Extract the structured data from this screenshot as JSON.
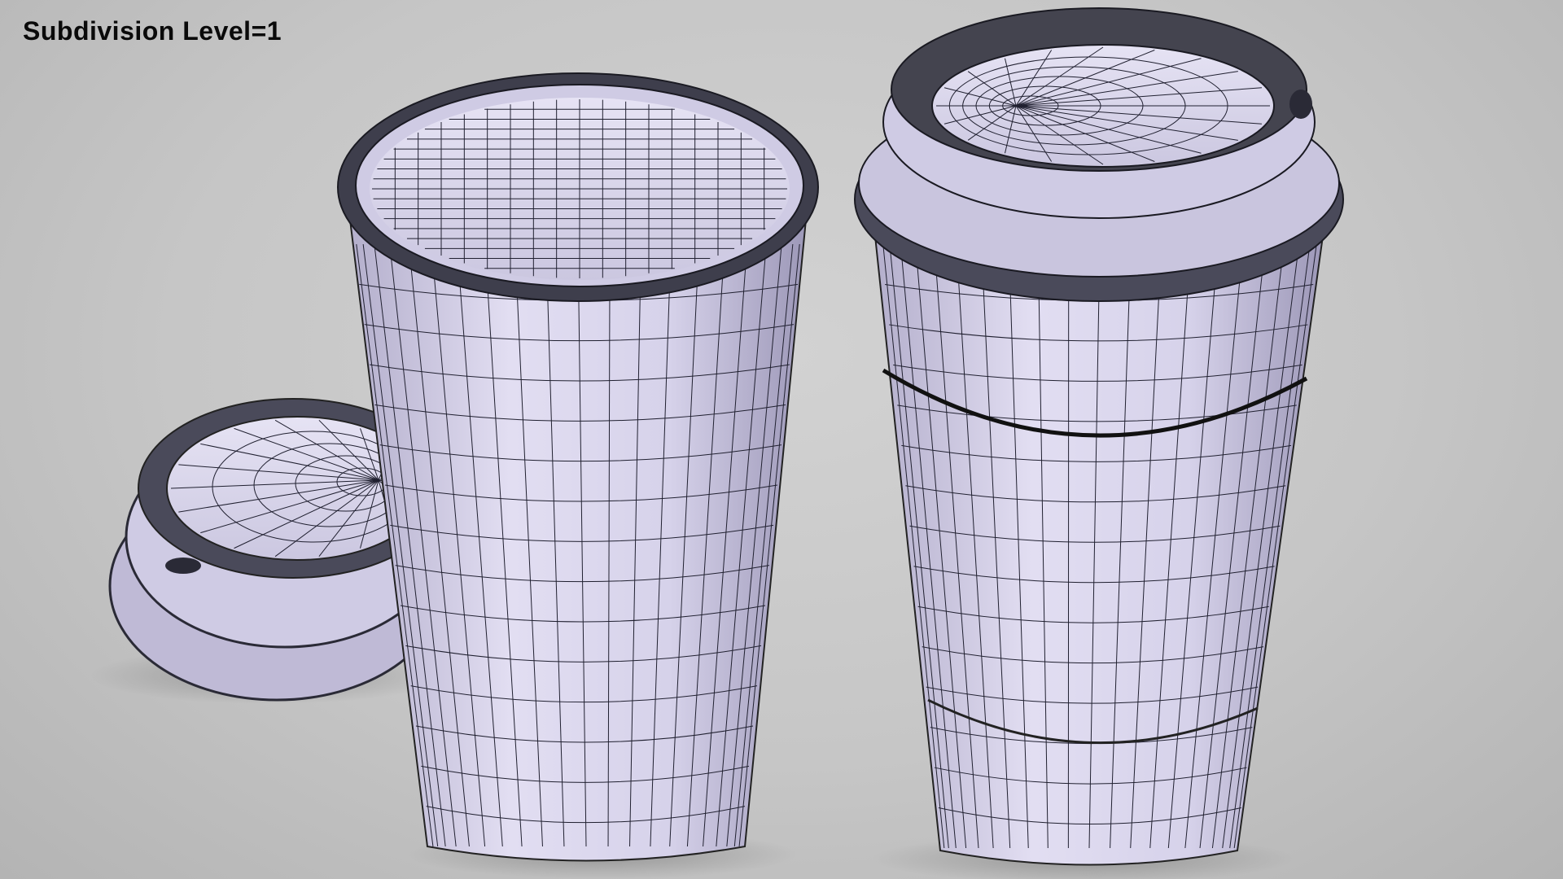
{
  "overlay": {
    "label": "Subdivision Level=1"
  },
  "scene": {
    "objects": [
      "open-cup",
      "loose-lid",
      "lidded-cup-with-sleeve"
    ],
    "colors": {
      "background": "#c8c8c8",
      "surface": "#dcd8ee",
      "surface_shade": "#a9a4c2",
      "wire": "#1c1c28",
      "rim_dark": "#3a3a48"
    }
  }
}
